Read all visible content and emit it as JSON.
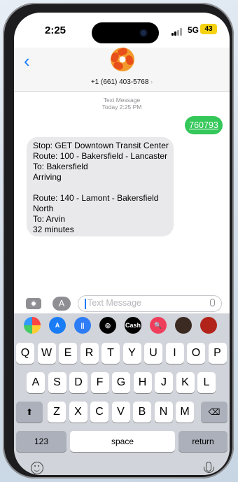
{
  "status_bar": {
    "time": "2:25",
    "network": "5G",
    "battery": "43"
  },
  "header": {
    "back_icon": "chevron-left-icon",
    "contact_number": "+1 (661) 403-5768",
    "chevron": "›"
  },
  "thread": {
    "meta_line1": "Text Message",
    "meta_line2": "Today 2:25 PM",
    "outgoing": {
      "text": "760793"
    },
    "incoming_lines": [
      "Stop: GET Downtown Transit Center",
      "Route: 100 - Bakersfield - Lancaster",
      "To: Bakersfield",
      "Arriving",
      "",
      "Route: 140 - Lamont - Bakersfield",
      "North",
      "To: Arvin",
      "32 minutes"
    ]
  },
  "compose": {
    "placeholder": "Text Message",
    "apps_glyph": "A"
  },
  "app_strip": [
    {
      "name": "photos-app-icon",
      "color": "#ffffff",
      "label": ""
    },
    {
      "name": "appstore-app-icon",
      "color": "#1a7cf5",
      "label": "A"
    },
    {
      "name": "audio-app-icon",
      "color": "#2f7df6",
      "label": "||"
    },
    {
      "name": "fitness-app-icon",
      "color": "#000000",
      "label": "◎"
    },
    {
      "name": "cash-app-icon",
      "color": "#000000",
      "label": "Cash"
    },
    {
      "name": "search-app-icon",
      "color": "#ef3e5b",
      "label": "🔍"
    },
    {
      "name": "memoji-app-icon",
      "color": "#3a2a22",
      "label": ""
    },
    {
      "name": "stickers-app-icon",
      "color": "#b2231a",
      "label": ""
    }
  ],
  "keyboard": {
    "row1": [
      "Q",
      "W",
      "E",
      "R",
      "T",
      "Y",
      "U",
      "I",
      "O",
      "P"
    ],
    "row2": [
      "A",
      "S",
      "D",
      "F",
      "G",
      "H",
      "J",
      "K",
      "L"
    ],
    "row3": [
      "Z",
      "X",
      "C",
      "V",
      "B",
      "N",
      "M"
    ],
    "numbers_label": "123",
    "space_label": "space",
    "return_label": "return",
    "shift_glyph": "⬆",
    "delete_glyph": "⌫"
  }
}
